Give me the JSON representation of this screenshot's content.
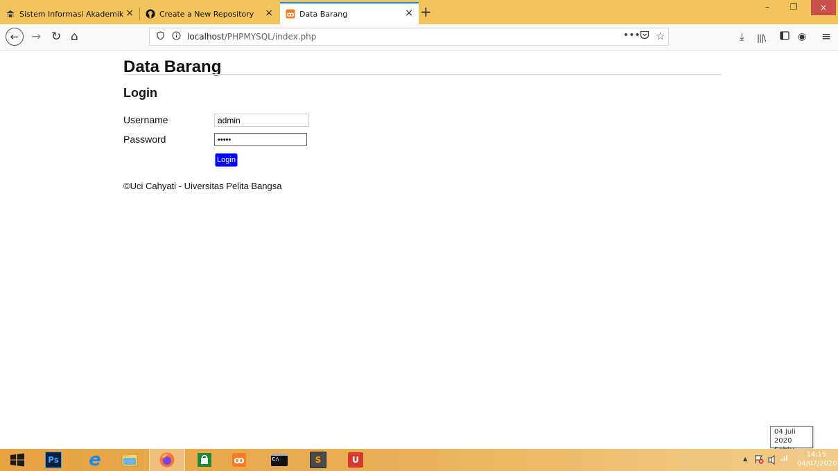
{
  "browser": {
    "tabs": [
      {
        "label": "Sistem Informasi Akademik",
        "close": "×",
        "icon": "school-icon"
      },
      {
        "label": "Create a New Repository",
        "close": "×",
        "icon": "github-icon"
      },
      {
        "label": "Data Barang",
        "close": "×",
        "icon": "xampp-icon",
        "active": true
      }
    ],
    "new_tab": "+",
    "window_controls": {
      "minimize": "–",
      "maximize": "❐",
      "close": "×"
    },
    "nav": {
      "back": "←",
      "forward": "→",
      "reload": "↻",
      "home": "⌂"
    },
    "url": {
      "host": "localhost",
      "path": "/PHPMYSQL/index.php",
      "more": "•••",
      "pocket": "◡",
      "star": "☆"
    },
    "toolbar_right": {
      "download": "⤓",
      "library": "|||\\",
      "sidebar": "▯",
      "account": "◉",
      "menu": "≡"
    }
  },
  "page": {
    "heading": "Data Barang",
    "subheading": "Login",
    "username_label": "Username",
    "username_value": "admin",
    "password_label": "Password",
    "password_value": "•••••",
    "login_button": "Login",
    "footer": "©Uci Cahyati - Uiversitas Pelita Bangsa"
  },
  "tooltip": {
    "date": "04 Juli 2020",
    "day": "Sabtu"
  },
  "taskbar": {
    "items": [
      {
        "name": "start-icon",
        "glyph": "⊞"
      },
      {
        "name": "photoshop-icon",
        "glyph": "Ps"
      },
      {
        "name": "internet-explorer-icon",
        "glyph": "e"
      },
      {
        "name": "file-explorer-icon",
        "glyph": "▤"
      },
      {
        "name": "firefox-icon",
        "glyph": "●"
      },
      {
        "name": "store-icon",
        "glyph": "🛍"
      },
      {
        "name": "xampp-icon",
        "glyph": "ꝏ"
      },
      {
        "name": "terminal-icon",
        "glyph": "C:\\"
      },
      {
        "name": "sublime-icon",
        "glyph": "S"
      },
      {
        "name": "app-icon",
        "glyph": "U"
      }
    ],
    "clock_time": "14:15",
    "clock_date": "04/07/2020",
    "tray": {
      "up": "▲",
      "flag": "⚑",
      "network": "▥",
      "signal": ".ıl"
    }
  },
  "colors": {
    "accent": "#0a84ff",
    "titlebar": "#f2c55c",
    "taskbar": "#eab058",
    "login_button": "#0000ff",
    "close_button": "#c7504a"
  }
}
